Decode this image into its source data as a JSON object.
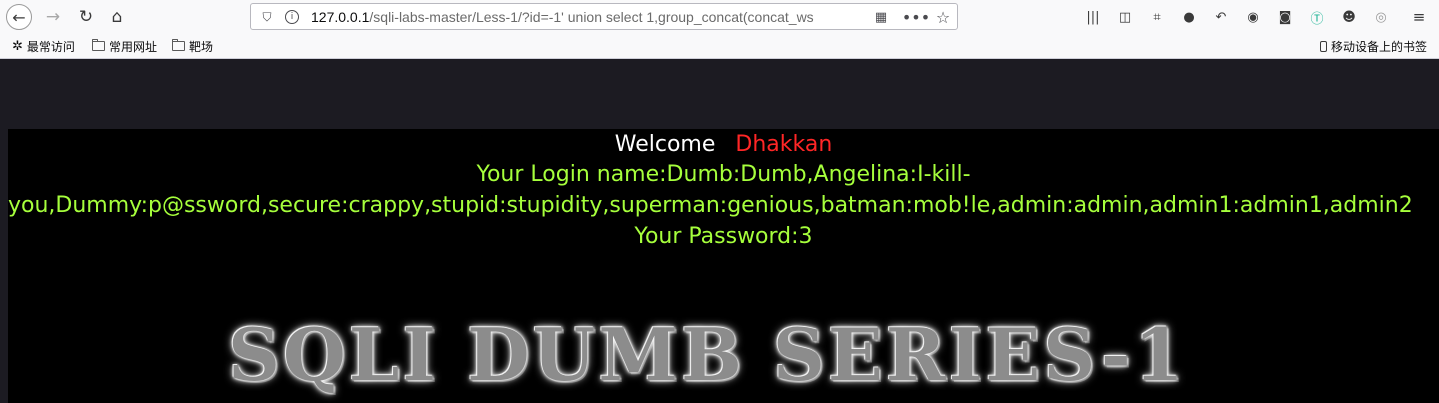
{
  "browser": {
    "url_host": "127.0.0.1",
    "url_path": "/sqli-labs-master/Less-1/?id=-1' union select 1,group_concat(concat_ws",
    "bookmarks": [
      {
        "label": "最常访问",
        "icon": "gear-icon"
      },
      {
        "label": "常用网址",
        "icon": "folder-icon"
      },
      {
        "label": "靶场",
        "icon": "folder-icon"
      }
    ],
    "mobile_bookmarks": "移动设备上的书签",
    "toolbar_icons": [
      "library-icon",
      "reader-view-icon",
      "screenshot-icon",
      "chat-icon",
      "undo-icon",
      "account-icon",
      "sync-icon",
      "translate-icon",
      "ninja-icon",
      "circle-icon",
      "menu-icon"
    ]
  },
  "page": {
    "welcome_label": "Welcome",
    "welcome_name": "Dhakkan",
    "login_line1": "Your Login name:Dumb:Dumb,Angelina:I-kill-",
    "login_line2": "you,Dummy:p@ssword,secure:crappy,stupid:stupidity,superman:genious,batman:mob!le,admin:admin,admin1:admin1,admin2",
    "password_line": "Your Password:3",
    "banner": "SQLI DUMB SERIES-1"
  },
  "colors": {
    "background": "#000000",
    "welcome": "#ffffff",
    "name": "#ff2626",
    "info": "#a6ff3c"
  }
}
